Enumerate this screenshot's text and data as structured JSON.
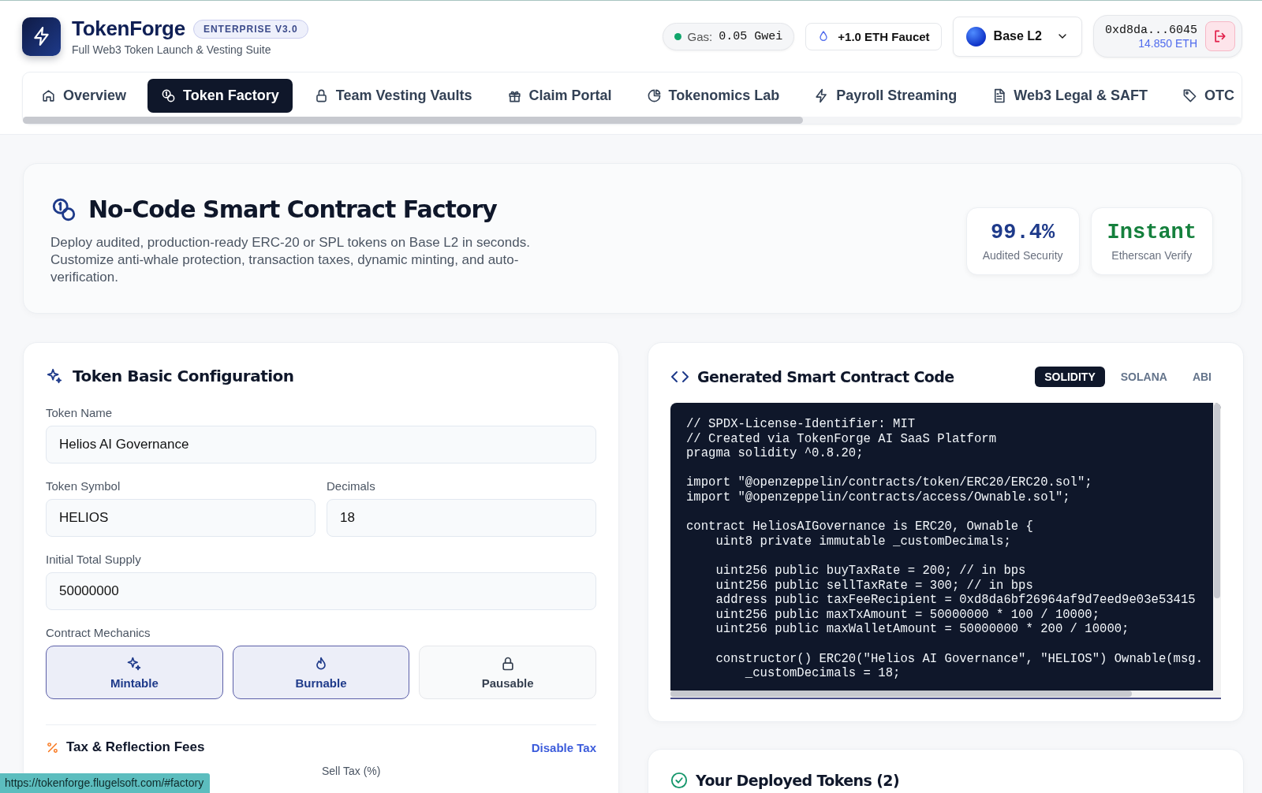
{
  "app": {
    "name": "TokenForge",
    "badge": "ENTERPRISE V3.0",
    "tagline": "Full Web3 Token Launch & Vesting Suite"
  },
  "gas": {
    "label": "Gas:",
    "value": "0.05 Gwei"
  },
  "faucet": {
    "label": "+1.0 ETH Faucet"
  },
  "network": {
    "name": "Base L2"
  },
  "wallet": {
    "address": "0xd8da...6045",
    "balance": "14.850 ETH"
  },
  "tabs": [
    {
      "label": "Overview",
      "selected": false
    },
    {
      "label": "Token Factory",
      "selected": true
    },
    {
      "label": "Team Vesting Vaults",
      "selected": false
    },
    {
      "label": "Claim Portal",
      "selected": false
    },
    {
      "label": "Tokenomics Lab",
      "selected": false
    },
    {
      "label": "Payroll Streaming",
      "selected": false
    },
    {
      "label": "Web3 Legal & SAFT",
      "selected": false
    },
    {
      "label": "OTC",
      "selected": false
    }
  ],
  "hero": {
    "title": "No-Code Smart Contract Factory",
    "description": "Deploy audited, production-ready ERC-20 or SPL tokens on Base L2 in seconds. Customize anti-whale protection, transaction taxes, dynamic minting, and auto-verification.",
    "stats": [
      {
        "value": "99.4%",
        "label": "Audited Security",
        "color": "#1e3a8a"
      },
      {
        "value": "Instant",
        "label": "Etherscan Verify",
        "color": "#15803d"
      }
    ]
  },
  "config": {
    "title": "Token Basic Configuration",
    "fields": [
      {
        "label": "Token Name",
        "value": "Helios AI Governance"
      },
      {
        "label": "Token Symbol",
        "value": "HELIOS"
      },
      {
        "label": "Decimals",
        "value": "18"
      },
      {
        "label": "Initial Total Supply",
        "value": "50000000"
      }
    ],
    "mechanics_label": "Contract Mechanics",
    "mechanics": [
      {
        "label": "Mintable",
        "selected": true
      },
      {
        "label": "Burnable",
        "selected": true
      },
      {
        "label": "Pausable",
        "selected": false
      }
    ],
    "tax": {
      "title": "Tax & Reflection Fees",
      "action": "Disable Tax",
      "sell_label": "Sell Tax (%)"
    }
  },
  "code": {
    "title": "Generated Smart Contract Code",
    "tabs": [
      {
        "label": "SOLIDITY",
        "selected": true
      },
      {
        "label": "SOLANA",
        "selected": false
      },
      {
        "label": "ABI",
        "selected": false
      }
    ],
    "blocks": [
      [
        "// SPDX-License-Identifier: MIT",
        "// Created via TokenForge AI SaaS Platform",
        "pragma solidity ^0.8.20;"
      ],
      [
        "import \"@openzeppelin/contracts/token/ERC20/ERC20.sol\";",
        "import \"@openzeppelin/contracts/access/Ownable.sol\";"
      ],
      [
        "contract HeliosAIGovernance is ERC20, Ownable {",
        "    uint8 private immutable _customDecimals;"
      ],
      [
        "    uint256 public buyTaxRate = 200; // in bps",
        "    uint256 public sellTaxRate = 300; // in bps",
        "    address public taxFeeRecipient = 0xd8da6bf26964af9d7eed9e03e53415",
        "    uint256 public maxTxAmount = 50000000 * 100 / 10000;",
        "    uint256 public maxWalletAmount = 50000000 * 200 / 10000;"
      ],
      [
        "    constructor() ERC20(\"Helios AI Governance\", \"HELIOS\") Ownable(msg.",
        "        _customDecimals = 18;"
      ]
    ]
  },
  "deployed": {
    "title": "Your Deployed Tokens (2)"
  },
  "status_bar": {
    "url": "https://tokenforge.flugelsoft.com/#factory"
  }
}
